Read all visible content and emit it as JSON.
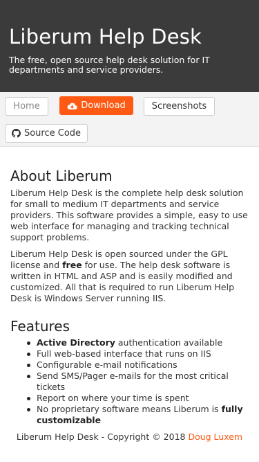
{
  "header": {
    "title": "Liberum Help Desk",
    "tagline": "The free, open source help desk solution for IT departments and service providers."
  },
  "nav": {
    "home": "Home",
    "download": "Download",
    "screenshots": "Screenshots",
    "source_code": "Source Code",
    "download_icon": "cloud-download-icon",
    "source_icon": "github-icon",
    "accent_color": "#ff5a13"
  },
  "about": {
    "title": "About Liberum",
    "p1": "Liberum Help Desk is the complete help desk solution for small to medium IT departments and service providers. This software provides a simple, easy to use web interface for managing and tracking technical support problems.",
    "p2_before": "Liberum Help Desk is open sourced under the GPL license and ",
    "p2_bold": "free",
    "p2_after": " for use. The help desk software is written in HTML and ASP and is easily modified and customized. All that is required to run Liberum Help Desk is Windows Server running IIS."
  },
  "features": {
    "title": "Features",
    "items": [
      {
        "bold": "Active Directory",
        "text": " authentication available"
      },
      {
        "text": "Full web-based interface that runs on IIS"
      },
      {
        "text": "Configurable e-mail notifications"
      },
      {
        "text": "Send SMS/Pager e-mails for the most critical tickets"
      },
      {
        "text": "Report on where your time is spent"
      },
      {
        "text": "No proprietary software means Liberum is ",
        "bold_end": "fully customizable"
      }
    ]
  },
  "footer": {
    "text": "Liberum Help Desk - Copyright © 2018 ",
    "author": "Doug Luxem"
  }
}
